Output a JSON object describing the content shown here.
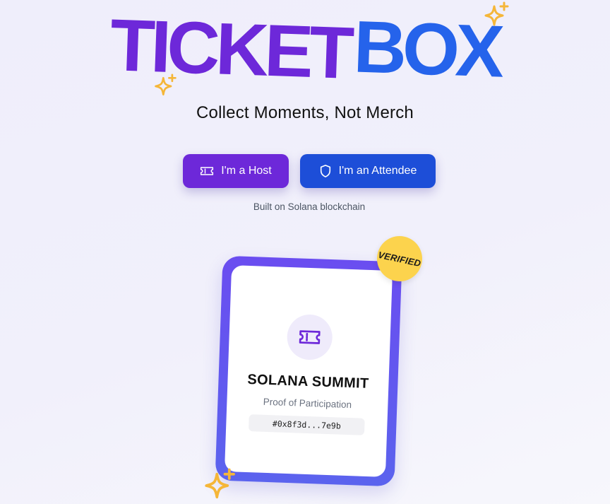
{
  "logo": {
    "part1": "TICKET",
    "part2": "BOX",
    "colors": {
      "part1": "#6d28d9",
      "part2": "#2563eb",
      "sparkle": "#f5b638"
    }
  },
  "tagline": "Collect Moments, Not Merch",
  "buttons": {
    "host": {
      "label": "I'm a Host",
      "icon": "ticket-icon",
      "color": "#6d28d9"
    },
    "attendee": {
      "label": "I'm an Attendee",
      "icon": "shield-icon",
      "color": "#1d4ed8"
    }
  },
  "built_on": "Built on Solana blockchain",
  "card": {
    "badge": "VERIFIED",
    "icon": "ticket-icon",
    "event_name": "SOLANA SUMMIT",
    "subtitle": "Proof of Participation",
    "hash": "#0x8f3d...7e9b"
  },
  "decorations": [
    "sparkle-icon",
    "sparkle-icon",
    "sparkle-icon"
  ]
}
